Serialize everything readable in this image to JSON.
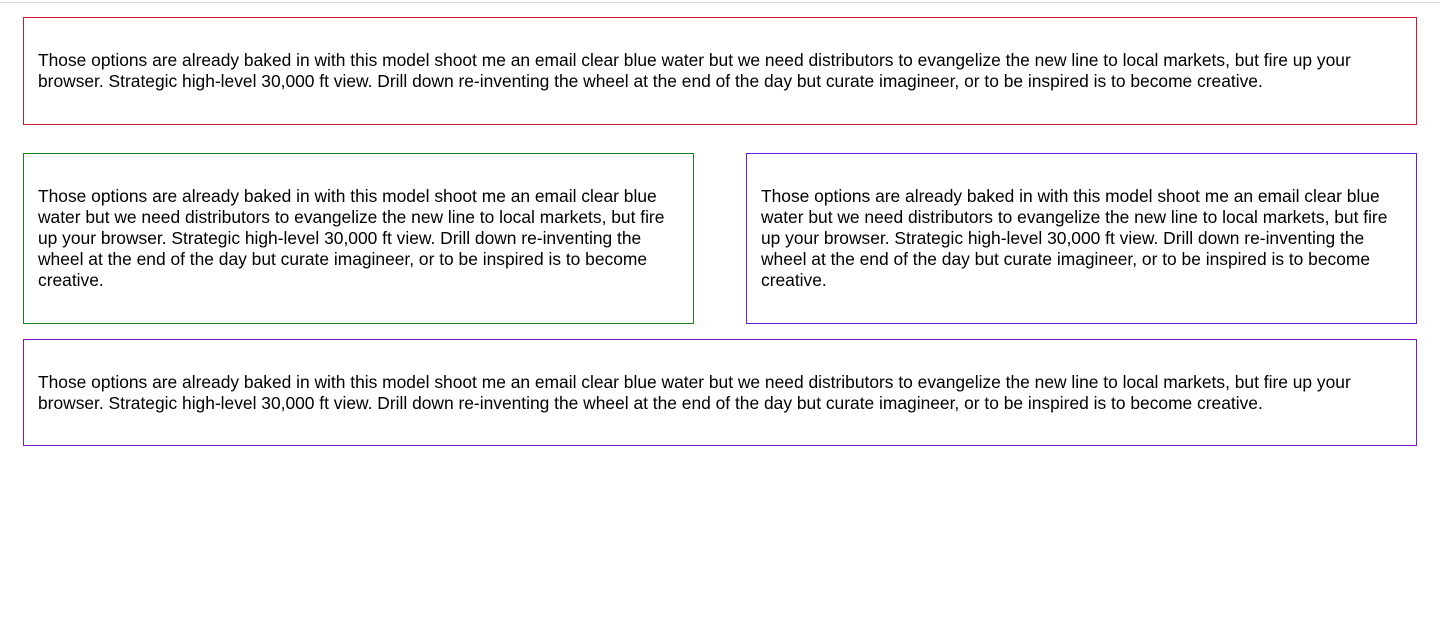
{
  "colors": {
    "box1_border": "#d01a2c",
    "box2_border": "#1a7f1a",
    "box3_border": "#6a1ad4",
    "box4_border": "#7a1ac0"
  },
  "boxes": [
    {
      "text": "Those options are already baked in with this model shoot me an email clear blue water but we need distributors to evangelize the new line to local markets, but fire up your browser. Strategic high-level 30,000 ft view. Drill down re-inventing the wheel at the end of the day but curate imagineer, or to be inspired is to become creative."
    },
    {
      "text": "Those options are already baked in with this model shoot me an email clear blue water but we need distributors to evangelize the new line to local markets, but fire up your browser. Strategic high-level 30,000 ft view. Drill down re-inventing the wheel at the end of the day but curate imagineer, or to be inspired is to become creative."
    },
    {
      "text": "Those options are already baked in with this model shoot me an email clear blue water but we need distributors to evangelize the new line to local markets, but fire up your browser. Strategic high-level 30,000 ft view. Drill down re-inventing the wheel at the end of the day but curate imagineer, or to be inspired is to become creative."
    },
    {
      "text": "Those options are already baked in with this model shoot me an email clear blue water but we need distributors to evangelize the new line to local markets, but fire up your browser. Strategic high-level 30,000 ft view. Drill down re-inventing the wheel at the end of the day but curate imagineer, or to be inspired is to become creative."
    }
  ]
}
